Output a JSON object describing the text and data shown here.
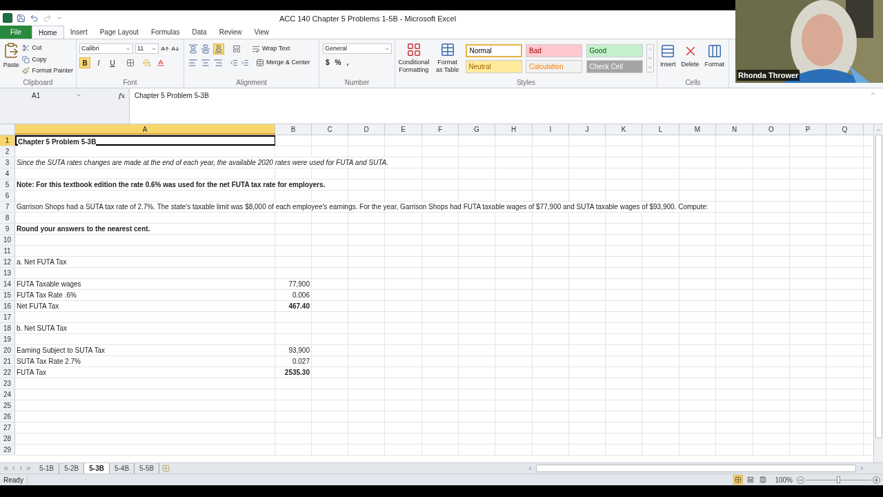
{
  "window": {
    "title": "ACC 140 Chapter 5 Problems 1-5B  -  Microsoft Excel"
  },
  "menu_tabs": [
    {
      "label": "File",
      "kind": "file",
      "selected": false
    },
    {
      "label": "Home",
      "kind": "tab",
      "selected": true
    },
    {
      "label": "Insert",
      "kind": "tab",
      "selected": false
    },
    {
      "label": "Page Layout",
      "kind": "tab",
      "selected": false
    },
    {
      "label": "Formulas",
      "kind": "tab",
      "selected": false
    },
    {
      "label": "Data",
      "kind": "tab",
      "selected": false
    },
    {
      "label": "Review",
      "kind": "tab",
      "selected": false
    },
    {
      "label": "View",
      "kind": "tab",
      "selected": false
    }
  ],
  "ribbon": {
    "clipboard": {
      "label": "Clipboard",
      "paste": "Paste",
      "cut": "Cut",
      "copy": "Copy",
      "format_painter": "Format Painter"
    },
    "font": {
      "label": "Font",
      "name": "Calibri",
      "size": "11",
      "bold": {
        "label": "B",
        "selected": true
      },
      "italic": {
        "label": "I",
        "selected": false
      },
      "underline": {
        "label": "U",
        "selected": false
      }
    },
    "alignment": {
      "label": "Alignment",
      "bottom_align": {
        "selected": true
      },
      "wrap_text": "Wrap Text",
      "merge_center": "Merge & Center"
    },
    "number": {
      "label": "Number",
      "format": "General",
      "currency": "$",
      "percent": "%",
      "comma": ","
    },
    "styles": {
      "label": "Styles",
      "conditional": "Conditional Formatting",
      "format_table": "Format as Table",
      "gallery": [
        {
          "label": "Normal",
          "color": "#ffffff",
          "selected": true
        },
        {
          "label": "Bad",
          "color": "#ffc7ce",
          "selected": false
        },
        {
          "label": "Good",
          "color": "#c6efce",
          "selected": false
        },
        {
          "label": "Neutral",
          "color": "#ffeb9c",
          "selected": false
        },
        {
          "label": "Calculation",
          "color": "#f2f2f2",
          "selected": false
        },
        {
          "label": "Check Cell",
          "color": "#a5a5a5",
          "selected": false
        }
      ]
    },
    "cells": {
      "label": "Cells",
      "insert": "Insert",
      "delete": "Delete",
      "format": "Format"
    }
  },
  "video_overlay": {
    "name": "Rhonda Thrower"
  },
  "formula_bar": {
    "name_box": "A1",
    "fx": "fx",
    "content": "Chapter 5 Problem 5-3B"
  },
  "columns": [
    {
      "label": "A",
      "selected": true
    },
    {
      "label": "B",
      "selected": false
    },
    {
      "label": "C",
      "selected": false
    },
    {
      "label": "D",
      "selected": false
    },
    {
      "label": "E",
      "selected": false
    },
    {
      "label": "F",
      "selected": false
    },
    {
      "label": "G",
      "selected": false
    },
    {
      "label": "H",
      "selected": false
    },
    {
      "label": "I",
      "selected": false
    },
    {
      "label": "J",
      "selected": false
    },
    {
      "label": "K",
      "selected": false
    },
    {
      "label": "L",
      "selected": false
    },
    {
      "label": "M",
      "selected": false
    },
    {
      "label": "N",
      "selected": false
    },
    {
      "label": "O",
      "selected": false
    },
    {
      "label": "P",
      "selected": false
    },
    {
      "label": "Q",
      "selected": false
    }
  ],
  "rows": [
    {
      "n": "1",
      "a": "Chapter 5 Problem 5-3B",
      "kind": "title",
      "selected": true
    },
    {
      "n": "2",
      "selected": false
    },
    {
      "n": "3",
      "a": "Since the SUTA rates changes are made at the end of each year, the available 2020 rates were used for FUTA and SUTA.",
      "kind": "remark",
      "selected": false
    },
    {
      "n": "4",
      "selected": false
    },
    {
      "n": "5",
      "a": "Note: For this textbook edition the rate 0.6% was used for the net FUTA tax rate for employers.",
      "kind": "title",
      "selected": false
    },
    {
      "n": "6",
      "selected": false
    },
    {
      "n": "7",
      "a": "Garrison Shops had a SUTA tax rate of 2.7%. The state's taxable limit was $8,000 of each employee's earnings. For the year, Garrison Shops had FUTA taxable wages of $77,900 and SUTA taxable wages of $93,900. Compute:",
      "kind": "text",
      "selected": false
    },
    {
      "n": "8",
      "selected": false
    },
    {
      "n": "9",
      "a": "Round your answers to the nearest cent.",
      "kind": "title",
      "selected": false
    },
    {
      "n": "10",
      "selected": false
    },
    {
      "n": "11",
      "selected": false
    },
    {
      "n": "12",
      "a": "a. Net FUTA Tax",
      "kind": "text",
      "selected": false
    },
    {
      "n": "13",
      "selected": false
    },
    {
      "n": "14",
      "a": "FUTA Taxable wages",
      "kind": "text",
      "b": "77,900",
      "selected": false
    },
    {
      "n": "15",
      "a": "FUTA Tax Rate .6%",
      "kind": "text",
      "b": "0.006",
      "selected": false
    },
    {
      "n": "16",
      "a": "Net FUTA Tax",
      "kind": "total",
      "b": "467.40",
      "selected": false
    },
    {
      "n": "17",
      "selected": false
    },
    {
      "n": "18",
      "a": "b. Net SUTA Tax",
      "kind": "text",
      "selected": false
    },
    {
      "n": "19",
      "selected": false
    },
    {
      "n": "20",
      "a": "Earning Subject to SUTA Tax",
      "kind": "text",
      "b": "93,900",
      "selected": false
    },
    {
      "n": "21",
      "a": "SUTA Tax Rate 2.7%",
      "kind": "text",
      "b": "0.027",
      "selected": false
    },
    {
      "n": "22",
      "a": "FUTA Tax",
      "kind": "total",
      "b": "2535.30",
      "selected": false
    },
    {
      "n": "23",
      "selected": false
    },
    {
      "n": "24",
      "selected": false
    },
    {
      "n": "25",
      "selected": false
    },
    {
      "n": "26",
      "selected": false
    },
    {
      "n": "27",
      "selected": false
    },
    {
      "n": "28",
      "selected": false
    },
    {
      "n": "29",
      "selected": false
    }
  ],
  "sheet_tabs": [
    {
      "label": "5-1B",
      "selected": false
    },
    {
      "label": "5-2B",
      "selected": false
    },
    {
      "label": "5-3B",
      "selected": true
    },
    {
      "label": "5-4B",
      "selected": false
    },
    {
      "label": "5-5B",
      "selected": false
    }
  ],
  "status_bar": {
    "status": "Ready",
    "zoom": "100%",
    "level": 0.5,
    "views": [
      {
        "selected": true
      },
      {
        "selected": false
      },
      {
        "selected": false
      }
    ]
  }
}
